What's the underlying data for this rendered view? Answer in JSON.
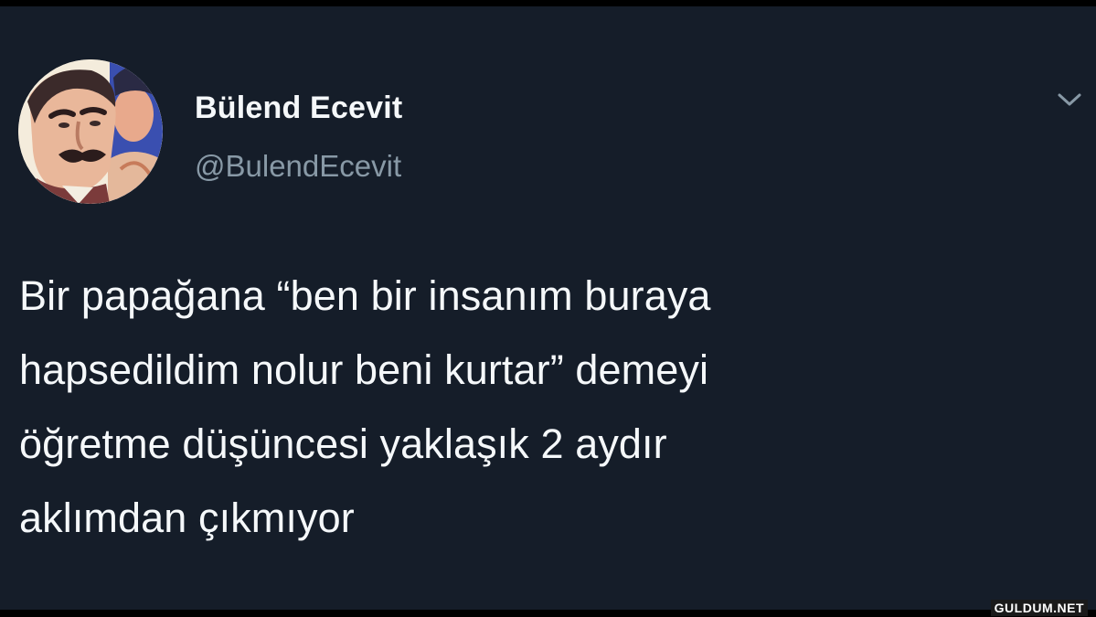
{
  "tweet": {
    "author": {
      "display_name": "Bülend Ecevit",
      "handle": "@BulendEcevit",
      "avatar_icon": "profile-photo-icon"
    },
    "menu_icon": "chevron-down-icon",
    "text": "Bir papağana “ben bir insanım buraya\nhapsedildim nolur beni kurtar” demeyi\nöğretme düşüncesi yaklaşık 2 aydır\naklımdan çıkmıyor"
  },
  "watermark": {
    "text": "GULDUM.NET"
  },
  "colors": {
    "background": "#151d29",
    "primary_text": "#f5f8fa",
    "secondary_text": "#8899a6"
  }
}
